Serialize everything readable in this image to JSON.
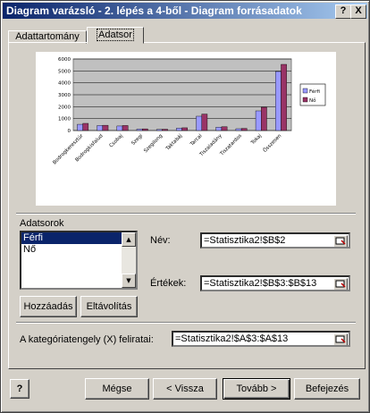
{
  "window": {
    "title": "Diagram varázsló - 2. lépés a 4-ből - Diagram forrásadatok",
    "help_btn": "?",
    "close_btn": "X"
  },
  "tabs": [
    {
      "label": "Adattartomány",
      "active": false
    },
    {
      "label": "Adatsor",
      "active": true
    }
  ],
  "chart_data": {
    "type": "bar",
    "categories": [
      "Bodrogkeresztúr",
      "Bodrogkisfalud",
      "Csobaj",
      "Szegi",
      "Szegilong",
      "Taktabáj",
      "Tarcal",
      "Tiszaladány",
      "Tiszatardos",
      "Tokaj",
      "Összesen"
    ],
    "series": [
      {
        "name": "Férfi",
        "values": [
          520,
          420,
          380,
          120,
          90,
          200,
          1200,
          280,
          150,
          1650,
          4950
        ],
        "color": "#9999ff"
      },
      {
        "name": "Nő",
        "values": [
          600,
          440,
          420,
          140,
          110,
          230,
          1380,
          320,
          180,
          1950,
          5550
        ],
        "color": "#993366"
      }
    ],
    "ylim": [
      0,
      6000
    ],
    "yticks": [
      "0",
      "1000",
      "2000",
      "3000",
      "4000",
      "5000",
      "6000"
    ],
    "plot_background": "#c0c0c0",
    "legend_position": "right",
    "grid": true
  },
  "series_section": {
    "title": "Adatsorok",
    "items": [
      "Férfi",
      "Nő"
    ],
    "selected_index": 0,
    "name_label": "Név:",
    "name_value": "=Statisztika2!$B$2",
    "values_label": "Értékek:",
    "values_value": "=Statisztika2!$B$3:$B$13",
    "add_button": "Hozzáadás",
    "remove_button": "Eltávolítás"
  },
  "category_axis": {
    "label": "A kategóriatengely (X) feliratai:",
    "value": "=Statisztika2!$A$3:$A$13"
  },
  "footer": {
    "help_icon": "?",
    "cancel": "Mégse",
    "back": "< Vissza",
    "next": "Tovább >",
    "finish": "Befejezés"
  }
}
